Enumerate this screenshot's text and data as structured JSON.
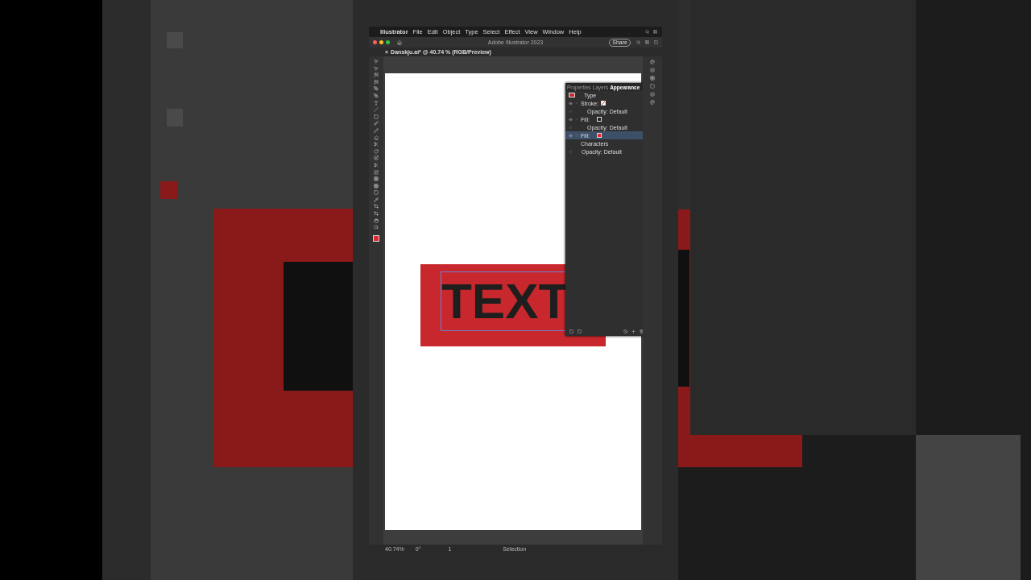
{
  "menu_bar": {
    "app": "Illustrator",
    "items": [
      "File",
      "Edit",
      "Object",
      "Type",
      "Select",
      "Effect",
      "View",
      "Window",
      "Help"
    ]
  },
  "title_bar": {
    "title": "Adobe Illustrator 2023",
    "share": "Share"
  },
  "document_tab": {
    "close": "×",
    "title": "Danskju.ai* @ 40.74 % (RGB/Preview)"
  },
  "artboard": {
    "text": "TEXT"
  },
  "appearance_panel": {
    "tabs": [
      {
        "label": "Properties",
        "selected": false
      },
      {
        "label": "Layers",
        "selected": false
      },
      {
        "label": "Appearance",
        "selected": true
      }
    ],
    "rows": [
      {
        "kind": "header",
        "label": "Type",
        "selected": false
      },
      {
        "kind": "stroke",
        "label": "Stroke:",
        "selected": false
      },
      {
        "kind": "opacity",
        "label": "Opacity:",
        "value": "Default",
        "selected": false
      },
      {
        "kind": "fill",
        "label": "Fill:",
        "color": "#262626",
        "selected": false
      },
      {
        "kind": "opacity",
        "label": "Opacity:",
        "value": "Default",
        "selected": false
      },
      {
        "kind": "fill",
        "label": "Fill:",
        "color": "#e0282e",
        "selected": true
      },
      {
        "kind": "characters",
        "label": "Characters",
        "selected": false
      },
      {
        "kind": "opacity",
        "label": "Opacity:",
        "value": "Default",
        "selected": false
      }
    ]
  },
  "status_bar": {
    "zoom": "40.74%",
    "rotation": "0°",
    "artboard": "1",
    "tool": "Selection"
  }
}
